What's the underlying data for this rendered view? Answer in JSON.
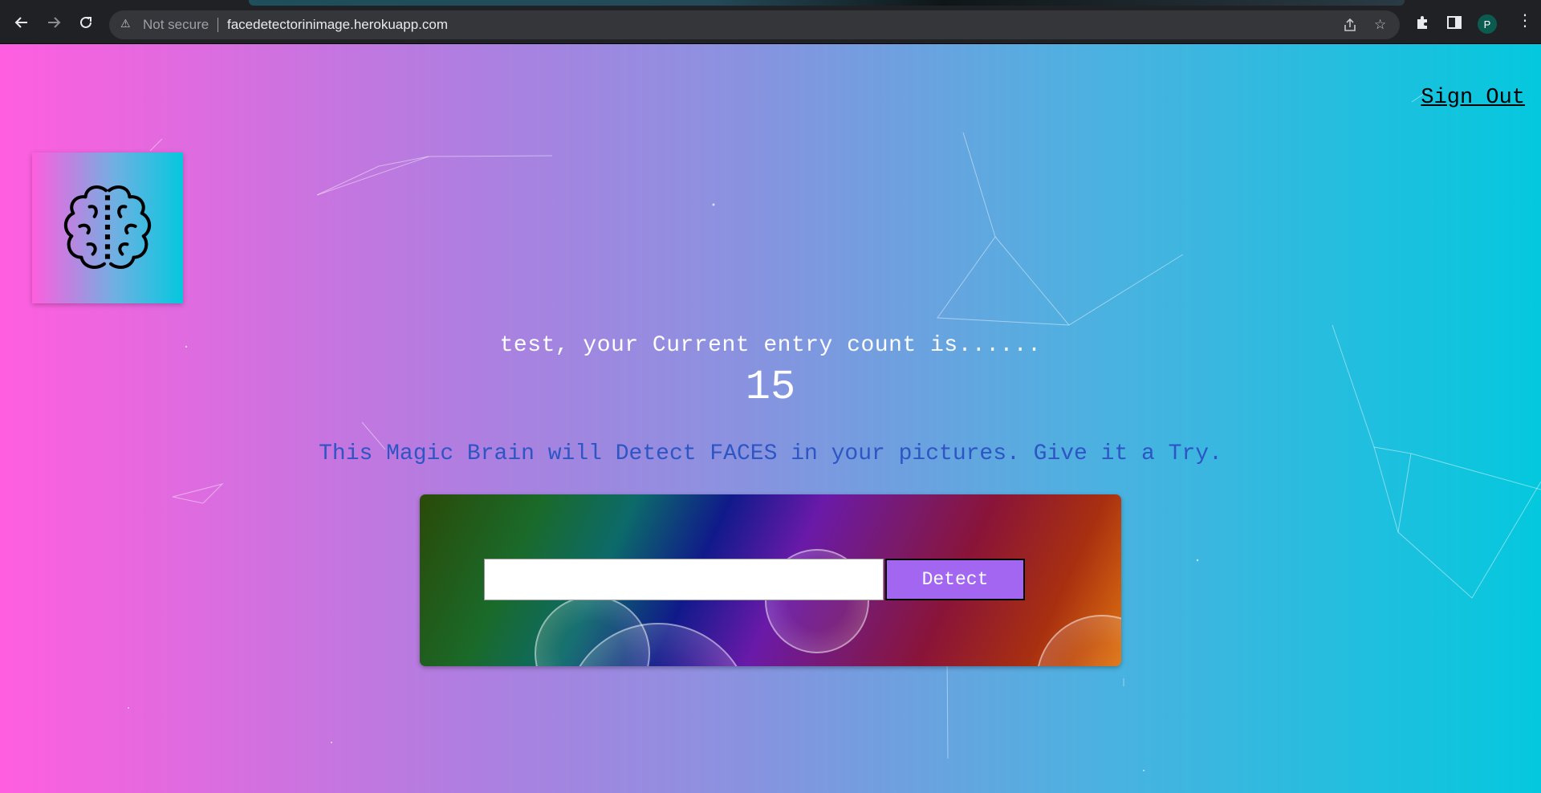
{
  "browser": {
    "security_label": "Not secure",
    "url": "facedetectorinimage.herokuapp.com",
    "profile_initial": "P",
    "icons": {
      "back": "back-arrow-icon",
      "forward": "forward-arrow-icon",
      "reload": "reload-icon",
      "warning": "warning-triangle-icon",
      "share": "share-icon",
      "bookmark": "star-icon",
      "extensions": "puzzle-icon",
      "side_panel": "side-panel-icon",
      "menu": "kebab-menu-icon"
    }
  },
  "page": {
    "signout_label": "Sign Out",
    "logo_icon": "brain-icon",
    "greeting": "test, your Current entry count is......",
    "entry_count": "15",
    "tagline": "This Magic Brain will Detect FACES in your pictures. Give it a Try.",
    "image_url_input": {
      "value": "",
      "placeholder": ""
    },
    "detect_label": "Detect"
  },
  "colors": {
    "gradient_left": "#ff5edf",
    "gradient_right": "#04c8de",
    "tagline": "#2d55c4",
    "detect_button": "#a366f0"
  }
}
